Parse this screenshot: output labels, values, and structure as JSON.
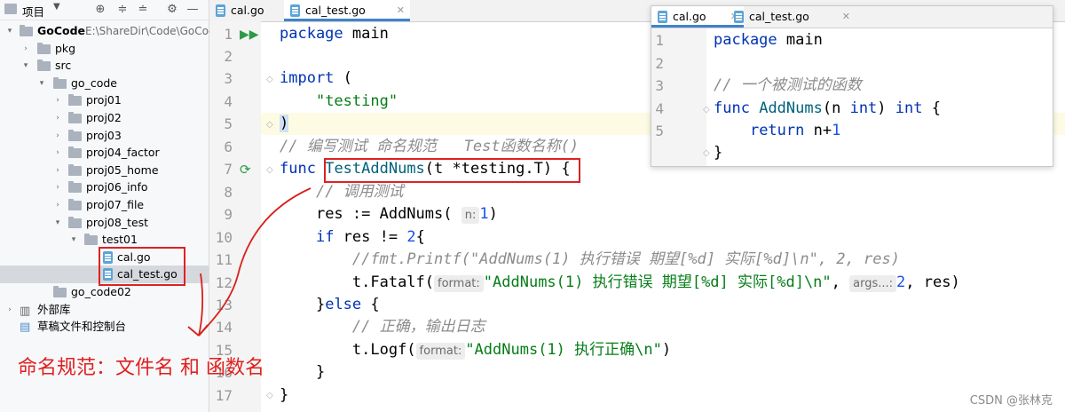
{
  "project_panel": {
    "title": "项目",
    "tree": [
      {
        "label": "GoCode",
        "path": "E:\\ShareDir\\Code\\GoCode",
        "type": "root",
        "expanded": true
      },
      {
        "label": "pkg",
        "type": "folder",
        "expanded": false
      },
      {
        "label": "src",
        "type": "folder",
        "expanded": true
      },
      {
        "label": "go_code",
        "type": "folder",
        "expanded": true
      },
      {
        "label": "proj01",
        "type": "folder",
        "expanded": false
      },
      {
        "label": "proj02",
        "type": "folder",
        "expanded": false
      },
      {
        "label": "proj03",
        "type": "folder",
        "expanded": false
      },
      {
        "label": "proj04_factor",
        "type": "folder",
        "expanded": false
      },
      {
        "label": "proj05_home",
        "type": "folder",
        "expanded": false
      },
      {
        "label": "proj06_info",
        "type": "folder",
        "expanded": false
      },
      {
        "label": "proj07_file",
        "type": "folder",
        "expanded": false
      },
      {
        "label": "proj08_test",
        "type": "folder",
        "expanded": true
      },
      {
        "label": "test01",
        "type": "folder",
        "expanded": true
      },
      {
        "label": "cal.go",
        "type": "file"
      },
      {
        "label": "cal_test.go",
        "type": "file",
        "selected": true
      },
      {
        "label": "go_code02",
        "type": "folder"
      },
      {
        "label": "外部库",
        "type": "library"
      },
      {
        "label": "草稿文件和控制台",
        "type": "scratch"
      }
    ]
  },
  "editor": {
    "tabs": [
      {
        "label": "cal.go",
        "active": false
      },
      {
        "label": "cal_test.go",
        "active": true
      }
    ],
    "line_numbers": [
      "1",
      "2",
      "3",
      "4",
      "5",
      "6",
      "7",
      "8",
      "9",
      "10",
      "11",
      "12",
      "13",
      "14",
      "15",
      "16",
      "17"
    ],
    "lines": {
      "l1": {
        "kw": "package",
        "name": "main"
      },
      "l3": {
        "kw": "import",
        "paren": "("
      },
      "l4": {
        "str": "\"testing\""
      },
      "l5": {
        "paren": ")"
      },
      "l6": {
        "comment": "// 编写测试 命名规范   Test函数名称()"
      },
      "l7": {
        "kw": "func",
        "fn": "TestAddNums",
        "params": "(t *testing.T)",
        "brace": " {"
      },
      "l8": {
        "comment": "// 调用测试"
      },
      "l9": {
        "code": "res := AddNums(",
        "hint": "n:",
        "num": "1",
        "close": ")"
      },
      "l10": {
        "kw": "if",
        "code": " res != ",
        "num": "2",
        "brace": "{"
      },
      "l11": {
        "comment": "//fmt.Printf(\"AddNums(1) 执行错误 期望[%d] 实际[%d]\\n\", 2, res)"
      },
      "l12": {
        "code": "t.Fatalf(",
        "hint1": "format:",
        "str": "\"AddNums(1) 执行错误 期望[%d] 实际[%d]\\n\"",
        "sep": ",",
        "hint2": "args...:",
        "num": "2",
        "rest": ", res)"
      },
      "l13": {
        "code": "}",
        "kw": "else",
        "brace": " {"
      },
      "l14": {
        "comment": "// 正确，输出日志"
      },
      "l15": {
        "code": "t.Logf(",
        "hint": "format:",
        "str": "\"AddNums(1) 执行正确\\n\"",
        "close": ")"
      },
      "l16": {
        "code": "}"
      },
      "l17": {
        "code": "}"
      }
    }
  },
  "popup": {
    "tabs": [
      {
        "label": "cal.go",
        "active": true
      },
      {
        "label": "cal_test.go",
        "active": false
      }
    ],
    "line_numbers": [
      "1",
      "2",
      "3",
      "4",
      "5"
    ],
    "lines": {
      "l1": {
        "kw": "package",
        "name": "main"
      },
      "l3": {
        "comment": "// 一个被测试的函数"
      },
      "l4": {
        "kw": "func",
        "fn": "AddNums",
        "params_a": "(n ",
        "type_a": "int",
        "params_b": ") ",
        "type_b": "int",
        "brace": " {"
      },
      "l5": {
        "kw": "return",
        "code": " n+",
        "num": "1"
      },
      "l6": {
        "code": "}"
      }
    }
  },
  "annotation": "命名规范：文件名  和  函数名",
  "watermark": "CSDN @张林克",
  "colors": {
    "keyword": "#0033b3",
    "string": "#067d17",
    "function": "#00627a",
    "comment": "#8c8c8c",
    "annotation": "#e02020",
    "accent": "#4083c9"
  }
}
